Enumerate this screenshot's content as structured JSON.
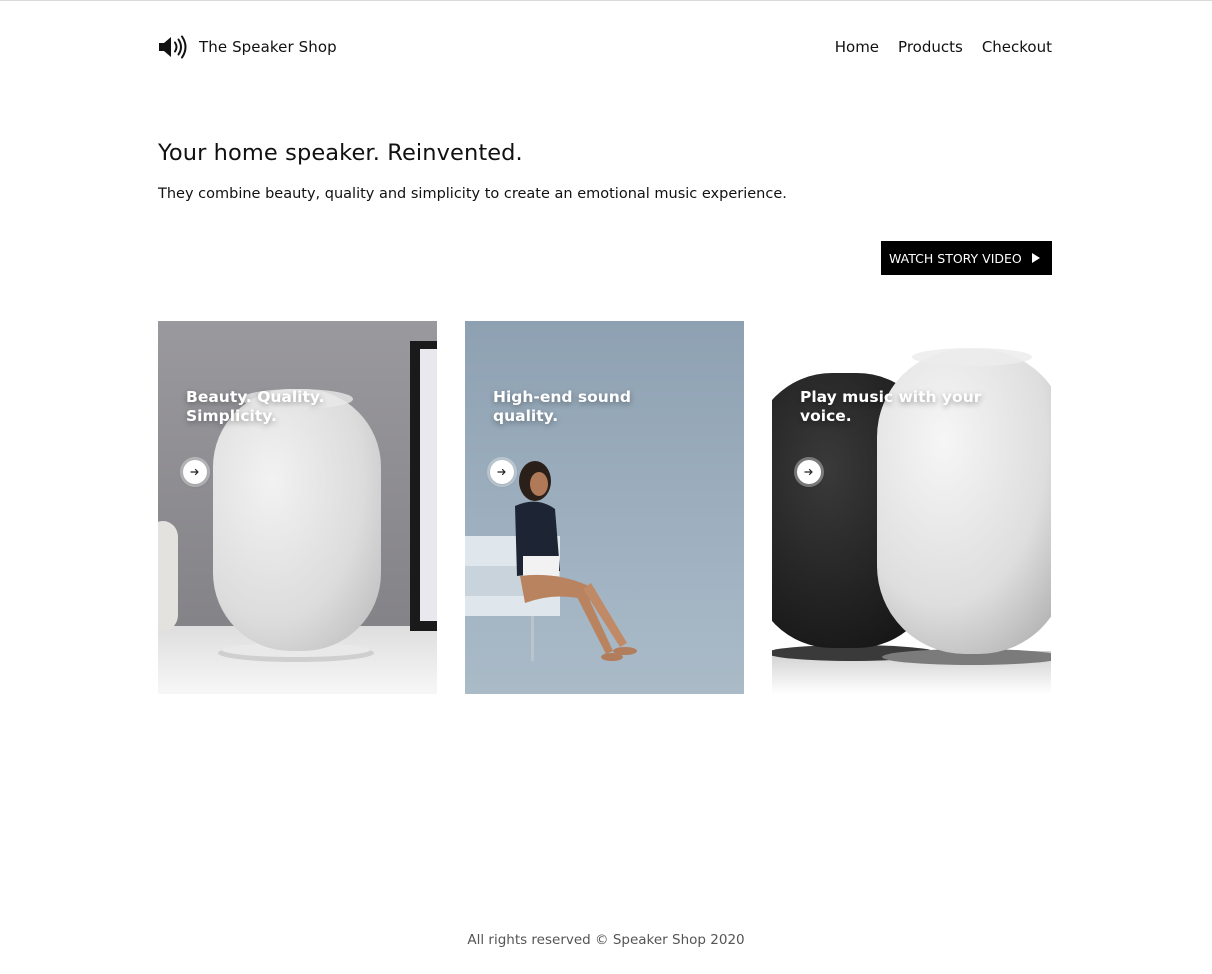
{
  "header": {
    "brand_name": "The Speaker Shop",
    "logo_icon": "speaker-icon",
    "nav": [
      {
        "label": "Home"
      },
      {
        "label": "Products"
      },
      {
        "label": "Checkout"
      }
    ]
  },
  "hero": {
    "title": "Your home speaker. Reinvented.",
    "subtitle": "They combine beauty, quality and simplicity to create an emotional music experience.",
    "cta_label": "WATCH STORY VIDEO",
    "cta_icon": "play-icon"
  },
  "cards": [
    {
      "caption": "Beauty. Quality. Simplicity.",
      "icon": "arrow-right-icon"
    },
    {
      "caption": "High-end sound quality.",
      "icon": "arrow-right-icon"
    },
    {
      "caption": "Play music with your voice.",
      "icon": "arrow-right-icon"
    }
  ],
  "footer": {
    "text": "All rights reserved © Speaker Shop 2020"
  },
  "colors": {
    "background": "#ffffff",
    "text": "#111111",
    "cta_background": "#000000",
    "cta_text": "#ffffff",
    "footer_text": "#555555"
  }
}
